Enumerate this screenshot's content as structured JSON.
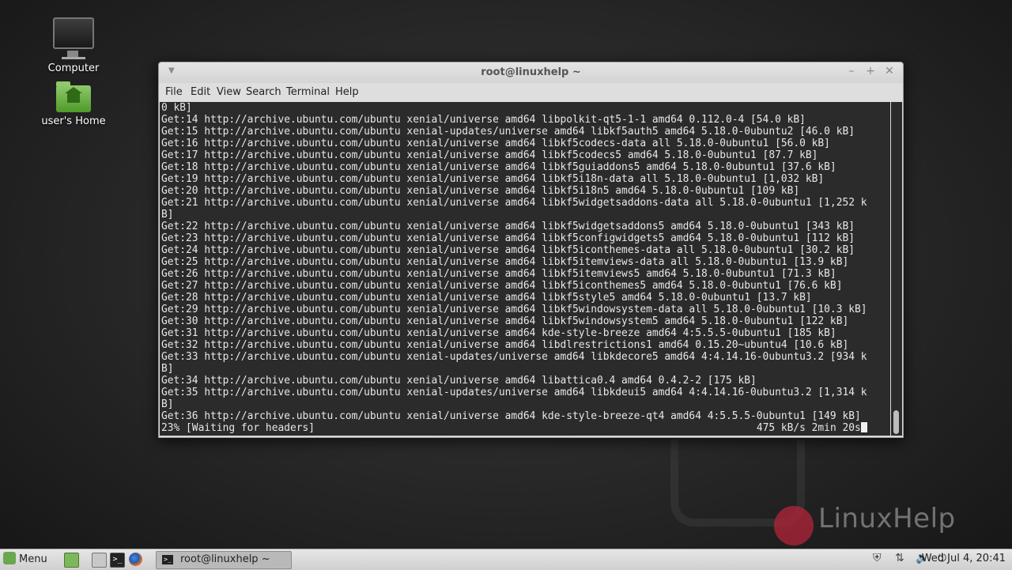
{
  "desktop": {
    "icons": [
      {
        "label": "Computer"
      },
      {
        "label": "user's Home"
      }
    ],
    "watermark_text": "LinuxHelp"
  },
  "terminal": {
    "title": "root@linuxhelp ~",
    "menu": [
      "File",
      "Edit",
      "View",
      "Search",
      "Terminal",
      "Help"
    ],
    "lines": [
      "0 kB]",
      "Get:14 http://archive.ubuntu.com/ubuntu xenial/universe amd64 libpolkit-qt5-1-1 amd64 0.112.0-4 [54.0 kB]",
      "Get:15 http://archive.ubuntu.com/ubuntu xenial-updates/universe amd64 libkf5auth5 amd64 5.18.0-0ubuntu2 [46.0 kB]",
      "Get:16 http://archive.ubuntu.com/ubuntu xenial/universe amd64 libkf5codecs-data all 5.18.0-0ubuntu1 [56.0 kB]",
      "Get:17 http://archive.ubuntu.com/ubuntu xenial/universe amd64 libkf5codecs5 amd64 5.18.0-0ubuntu1 [87.7 kB]",
      "Get:18 http://archive.ubuntu.com/ubuntu xenial/universe amd64 libkf5guiaddons5 amd64 5.18.0-0ubuntu1 [37.6 kB]",
      "Get:19 http://archive.ubuntu.com/ubuntu xenial/universe amd64 libkf5i18n-data all 5.18.0-0ubuntu1 [1,032 kB]",
      "Get:20 http://archive.ubuntu.com/ubuntu xenial/universe amd64 libkf5i18n5 amd64 5.18.0-0ubuntu1 [109 kB]",
      "Get:21 http://archive.ubuntu.com/ubuntu xenial/universe amd64 libkf5widgetsaddons-data all 5.18.0-0ubuntu1 [1,252 k",
      "B]",
      "Get:22 http://archive.ubuntu.com/ubuntu xenial/universe amd64 libkf5widgetsaddons5 amd64 5.18.0-0ubuntu1 [343 kB]",
      "Get:23 http://archive.ubuntu.com/ubuntu xenial/universe amd64 libkf5configwidgets5 amd64 5.18.0-0ubuntu1 [112 kB]",
      "Get:24 http://archive.ubuntu.com/ubuntu xenial/universe amd64 libkf5iconthemes-data all 5.18.0-0ubuntu1 [30.2 kB]",
      "Get:25 http://archive.ubuntu.com/ubuntu xenial/universe amd64 libkf5itemviews-data all 5.18.0-0ubuntu1 [13.9 kB]",
      "Get:26 http://archive.ubuntu.com/ubuntu xenial/universe amd64 libkf5itemviews5 amd64 5.18.0-0ubuntu1 [71.3 kB]",
      "Get:27 http://archive.ubuntu.com/ubuntu xenial/universe amd64 libkf5iconthemes5 amd64 5.18.0-0ubuntu1 [76.6 kB]",
      "Get:28 http://archive.ubuntu.com/ubuntu xenial/universe amd64 libkf5style5 amd64 5.18.0-0ubuntu1 [13.7 kB]",
      "Get:29 http://archive.ubuntu.com/ubuntu xenial/universe amd64 libkf5windowsystem-data all 5.18.0-0ubuntu1 [10.3 kB]",
      "Get:30 http://archive.ubuntu.com/ubuntu xenial/universe amd64 libkf5windowsystem5 amd64 5.18.0-0ubuntu1 [122 kB]",
      "Get:31 http://archive.ubuntu.com/ubuntu xenial/universe amd64 kde-style-breeze amd64 4:5.5.5-0ubuntu1 [185 kB]",
      "Get:32 http://archive.ubuntu.com/ubuntu xenial/universe amd64 libdlrestrictions1 amd64 0.15.20~ubuntu4 [10.6 kB]",
      "Get:33 http://archive.ubuntu.com/ubuntu xenial-updates/universe amd64 libkdecore5 amd64 4:4.14.16-0ubuntu3.2 [934 k",
      "B]",
      "Get:34 http://archive.ubuntu.com/ubuntu xenial/universe amd64 libattica0.4 amd64 0.4.2-2 [175 kB]",
      "Get:35 http://archive.ubuntu.com/ubuntu xenial-updates/universe amd64 libkdeui5 amd64 4:4.14.16-0ubuntu3.2 [1,314 k",
      "B]",
      "Get:36 http://archive.ubuntu.com/ubuntu xenial/universe amd64 kde-style-breeze-qt4 amd64 4:5.5.5-0ubuntu1 [149 kB]"
    ],
    "status_left": "23% [Waiting for headers]",
    "status_right": "475 kB/s 2min 20s"
  },
  "taskbar": {
    "menu_label": "Menu",
    "task_label": "root@linuxhelp ~",
    "clock": "Wed Jul 4, 20:41",
    "terminal_glyph": ">_"
  },
  "icons": {
    "computer": "computer-icon",
    "home": "home-folder-icon",
    "menu": "mint-menu-icon",
    "show_desktop": "show-desktop-icon",
    "files": "files-icon",
    "terminal": "terminal-icon",
    "firefox": "firefox-icon",
    "shield": "shield-icon",
    "network": "network-icon",
    "volume": "volume-icon",
    "power": "power-icon"
  },
  "colors": {
    "terminal_bg": "#2b2b2b",
    "terminal_fg": "#e8e8e8",
    "mint_green": "#6aa84f"
  }
}
